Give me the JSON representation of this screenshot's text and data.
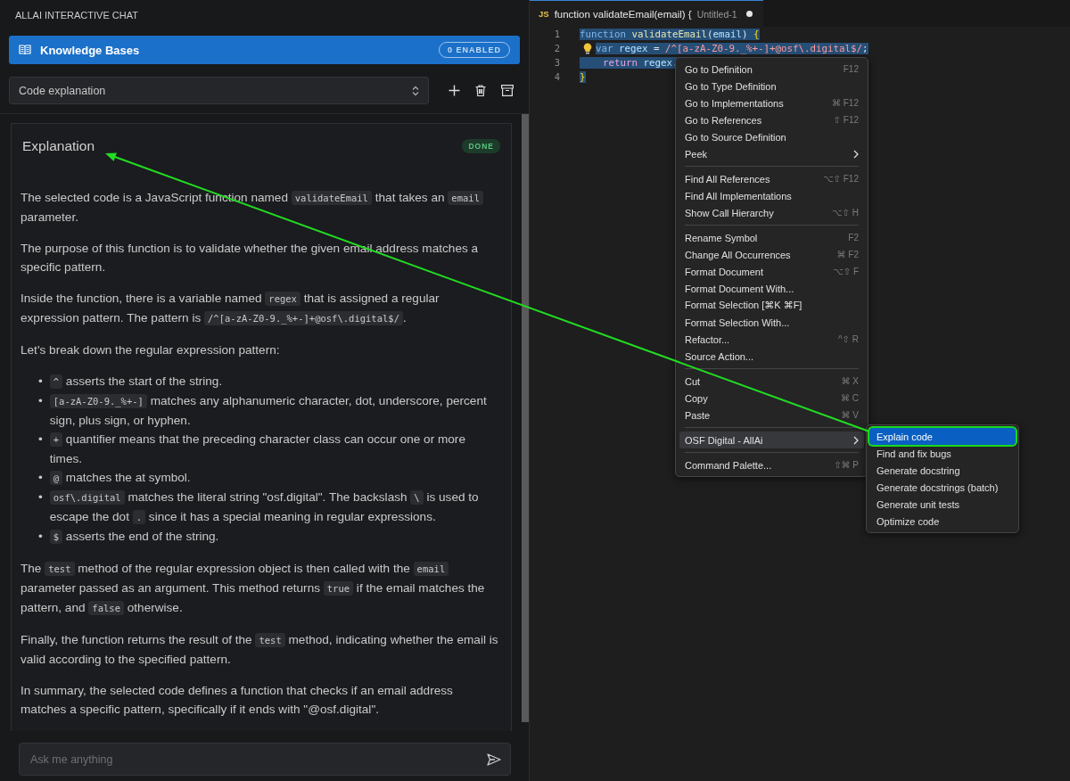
{
  "chat": {
    "title": "ALLAI INTERACTIVE CHAT",
    "knowledge_bases": {
      "label": "Knowledge Bases",
      "badge": "0 ENABLED"
    },
    "mode_select": {
      "value": "Code explanation"
    },
    "response": {
      "title": "Explanation",
      "status": "DONE",
      "blocks": [
        {
          "kind": "paragraph",
          "segments": [
            {
              "kind": "text",
              "text": "The selected code is a JavaScript function named "
            },
            {
              "kind": "code",
              "text": "validateEmail"
            },
            {
              "kind": "text",
              "text": " that takes an "
            },
            {
              "kind": "code",
              "text": "email"
            },
            {
              "kind": "text",
              "text": " parameter."
            }
          ]
        },
        {
          "kind": "paragraph",
          "segments": [
            {
              "kind": "text",
              "text": "The purpose of this function is to validate whether the given email address matches a specific pattern."
            }
          ]
        },
        {
          "kind": "paragraph",
          "segments": [
            {
              "kind": "text",
              "text": "Inside the function, there is a variable named "
            },
            {
              "kind": "code",
              "text": "regex"
            },
            {
              "kind": "text",
              "text": " that is assigned a regular expression pattern. The pattern is "
            },
            {
              "kind": "code",
              "text": "/^[a-zA-Z0-9._%+-]+@osf\\.digital$/"
            },
            {
              "kind": "text",
              "text": "."
            }
          ]
        },
        {
          "kind": "paragraph",
          "segments": [
            {
              "kind": "text",
              "text": "Let's break down the regular expression pattern:"
            }
          ]
        },
        {
          "kind": "list",
          "items": [
            {
              "bullet": "•",
              "segments": [
                {
                  "kind": "code",
                  "text": "^"
                },
                {
                  "kind": "text",
                  "text": " asserts the start of the string."
                }
              ]
            },
            {
              "bullet": "•",
              "segments": [
                {
                  "kind": "code",
                  "text": "[a-zA-Z0-9._%+-]"
                },
                {
                  "kind": "text",
                  "text": " matches any alphanumeric character, dot, underscore, percent sign, plus sign, or hyphen."
                }
              ]
            },
            {
              "bullet": "•",
              "segments": [
                {
                  "kind": "code",
                  "text": "+"
                },
                {
                  "kind": "text",
                  "text": " quantifier means that the preceding character class can occur one or more times."
                }
              ]
            },
            {
              "bullet": "•",
              "segments": [
                {
                  "kind": "code",
                  "text": "@"
                },
                {
                  "kind": "text",
                  "text": " matches the at symbol."
                }
              ]
            },
            {
              "bullet": "•",
              "segments": [
                {
                  "kind": "code",
                  "text": "osf\\.digital"
                },
                {
                  "kind": "text",
                  "text": " matches the literal string \"osf.digital\". The backslash "
                },
                {
                  "kind": "code",
                  "text": "\\"
                },
                {
                  "kind": "text",
                  "text": " is used to escape the dot "
                },
                {
                  "kind": "code",
                  "text": "."
                },
                {
                  "kind": "text",
                  "text": " since it has a special meaning in regular expressions."
                }
              ]
            },
            {
              "bullet": "•",
              "segments": [
                {
                  "kind": "code",
                  "text": "$"
                },
                {
                  "kind": "text",
                  "text": " asserts the end of the string."
                }
              ]
            }
          ]
        },
        {
          "kind": "paragraph",
          "segments": [
            {
              "kind": "text",
              "text": "The "
            },
            {
              "kind": "code",
              "text": "test"
            },
            {
              "kind": "text",
              "text": " method of the regular expression object is then called with the "
            },
            {
              "kind": "code",
              "text": "email"
            },
            {
              "kind": "text",
              "text": " parameter passed as an argument. This method returns "
            },
            {
              "kind": "code",
              "text": "true"
            },
            {
              "kind": "text",
              "text": " if the email matches the pattern, and "
            },
            {
              "kind": "code",
              "text": "false"
            },
            {
              "kind": "text",
              "text": " otherwise."
            }
          ]
        },
        {
          "kind": "paragraph",
          "segments": [
            {
              "kind": "text",
              "text": "Finally, the function returns the result of the "
            },
            {
              "kind": "code",
              "text": "test"
            },
            {
              "kind": "text",
              "text": " method, indicating whether the email is valid according to the specified pattern."
            }
          ]
        },
        {
          "kind": "paragraph",
          "segments": [
            {
              "kind": "text",
              "text": "In summary, the selected code defines a function that checks if an email address matches a specific pattern, specifically if it ends with \"@osf.digital\"."
            }
          ]
        }
      ]
    },
    "input": {
      "placeholder": "Ask me anything"
    }
  },
  "editor": {
    "tab": {
      "icon_text": "JS",
      "title": "function validateEmail(email) {",
      "file": "Untitled-1",
      "modified": true
    },
    "lines": [
      {
        "number": "1",
        "lightbulb": false,
        "tokens": [
          {
            "kind": "keyword",
            "text": "function"
          },
          {
            "kind": "function",
            "text": " validateEmail"
          },
          {
            "kind": "plain",
            "text": "("
          },
          {
            "kind": "variable",
            "text": "email"
          },
          {
            "kind": "plain",
            "text": ") "
          },
          {
            "kind": "brace",
            "text": "{"
          }
        ]
      },
      {
        "number": "2",
        "lightbulb": true,
        "tokens": [
          {
            "kind": "keyword",
            "text": "var"
          },
          {
            "kind": "variable",
            "text": " regex"
          },
          {
            "kind": "plain",
            "text": " = "
          },
          {
            "kind": "regex",
            "text": "/^[a-zA-Z0-9._%+-]+@osf\\.digital$/"
          },
          {
            "kind": "plain",
            "text": ";"
          }
        ]
      },
      {
        "number": "3",
        "lightbulb": false,
        "tokens": [
          {
            "kind": "control",
            "text": "    return"
          },
          {
            "kind": "variable",
            "text": " regex."
          }
        ]
      },
      {
        "number": "4",
        "lightbulb": false,
        "tokens": [
          {
            "kind": "brace",
            "text": "}"
          }
        ]
      }
    ]
  },
  "context_menu": {
    "groups": [
      [
        {
          "label": "Go to Definition",
          "shortcut": "F12",
          "submenu": false,
          "selected": false
        },
        {
          "label": "Go to Type Definition",
          "submenu": false,
          "selected": false
        },
        {
          "label": "Go to Implementations",
          "shortcut": "⌘ F12",
          "submenu": false,
          "selected": false
        },
        {
          "label": "Go to References",
          "shortcut": "⇧ F12",
          "submenu": false,
          "selected": false
        },
        {
          "label": "Go to Source Definition",
          "submenu": false,
          "selected": false
        },
        {
          "label": "Peek",
          "submenu": true,
          "selected": false
        }
      ],
      [
        {
          "label": "Find All References",
          "shortcut": "⌥⇧ F12",
          "submenu": false,
          "selected": false
        },
        {
          "label": "Find All Implementations",
          "submenu": false,
          "selected": false
        },
        {
          "label": "Show Call Hierarchy",
          "shortcut": "⌥⇧ H",
          "submenu": false,
          "selected": false
        }
      ],
      [
        {
          "label": "Rename Symbol",
          "shortcut": "F2",
          "submenu": false,
          "selected": false
        },
        {
          "label": "Change All Occurrences",
          "shortcut": "⌘ F2",
          "submenu": false,
          "selected": false
        },
        {
          "label": "Format Document",
          "shortcut": "⌥⇧ F",
          "submenu": false,
          "selected": false
        },
        {
          "label": "Format Document With...",
          "submenu": false,
          "selected": false
        },
        {
          "label": "Format Selection [⌘K ⌘F]",
          "submenu": false,
          "selected": false
        },
        {
          "label": "Format Selection With...",
          "submenu": false,
          "selected": false
        },
        {
          "label": "Refactor...",
          "shortcut": "^⇧ R",
          "submenu": false,
          "selected": false
        },
        {
          "label": "Source Action...",
          "submenu": false,
          "selected": false
        }
      ],
      [
        {
          "label": "Cut",
          "shortcut": "⌘ X",
          "submenu": false,
          "selected": false
        },
        {
          "label": "Copy",
          "shortcut": "⌘ C",
          "submenu": false,
          "selected": false
        },
        {
          "label": "Paste",
          "shortcut": "⌘ V",
          "submenu": false,
          "selected": false
        }
      ],
      [
        {
          "label": "OSF Digital - AllAi",
          "submenu": true,
          "selected": true
        }
      ],
      [
        {
          "label": "Command Palette...",
          "shortcut": "⇧⌘ P",
          "submenu": false,
          "selected": false
        }
      ]
    ]
  },
  "submenu": {
    "items": [
      {
        "label": "Explain code",
        "selected": true
      },
      {
        "label": "Find and fix bugs",
        "selected": false
      },
      {
        "label": "Generate docstring",
        "selected": false
      },
      {
        "label": "Generate docstrings (batch)",
        "selected": false
      },
      {
        "label": "Generate unit tests",
        "selected": false
      },
      {
        "label": "Optimize code",
        "selected": false
      }
    ]
  }
}
